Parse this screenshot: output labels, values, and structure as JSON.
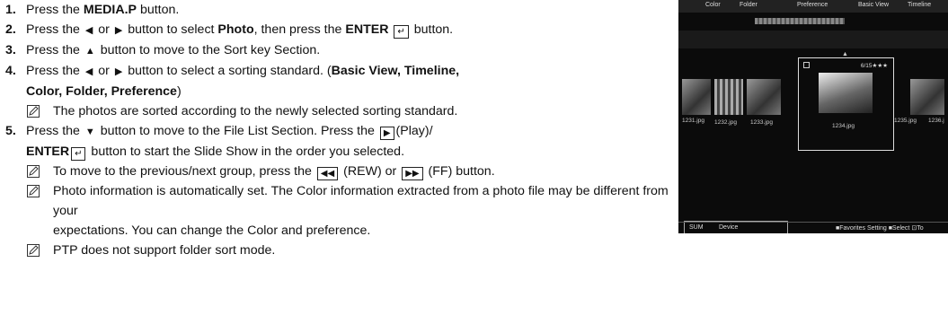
{
  "steps": [
    {
      "num": "1.",
      "pre": "Press the ",
      "b1": "MEDIA.P",
      "post": " button."
    },
    {
      "num": "2.",
      "pre": "Press the ",
      "mid1": " or ",
      "mid2": " button to select ",
      "b1": "Photo",
      "mid3": ", then press the ",
      "b2": "ENTER",
      "post": " button."
    },
    {
      "num": "3.",
      "pre": "Press the ",
      "post": " button to move to the Sort key Section."
    },
    {
      "num": "4.",
      "pre": "Press the ",
      "mid1": " or ",
      "post": " button to select a sorting standard. (",
      "b1": "Basic View, Timeline,",
      "b2": "Color, Folder, Preference",
      "close": ")"
    },
    {
      "num": "5.",
      "pre": "Press the ",
      "post": " button to move to the File List Section. Press the ",
      "play": "(Play)/",
      "b1": "ENTER",
      "post2": " button to start the Slide Show in the order you selected."
    }
  ],
  "notes": {
    "n4": "The photos are sorted according to the newly selected sorting standard.",
    "n5a_pre": "To move to the previous/next group, press the ",
    "n5a_mid": " (REW) or ",
    "n5a_post": " (FF) button.",
    "n5b_l1": "Photo information is automatically set. The Color information extracted from a photo file may be different from your",
    "n5b_l2": "expectations. You can change the Color and preference.",
    "n5c": "PTP does not support folder sort mode."
  },
  "screen": {
    "tabs": [
      "Color",
      "Folder",
      "Preference",
      "Basic View",
      "Timeline"
    ],
    "captions": [
      "1231.jpg",
      "1232.jpg",
      "1233.jpg",
      "1234.jpg",
      "1235.jpg",
      "1236.j"
    ],
    "rating": "6/15★★★",
    "footer_left": "SUM",
    "footer_device": "Device",
    "footer_right": "■Favorites Setting ■Select ⊡To"
  }
}
